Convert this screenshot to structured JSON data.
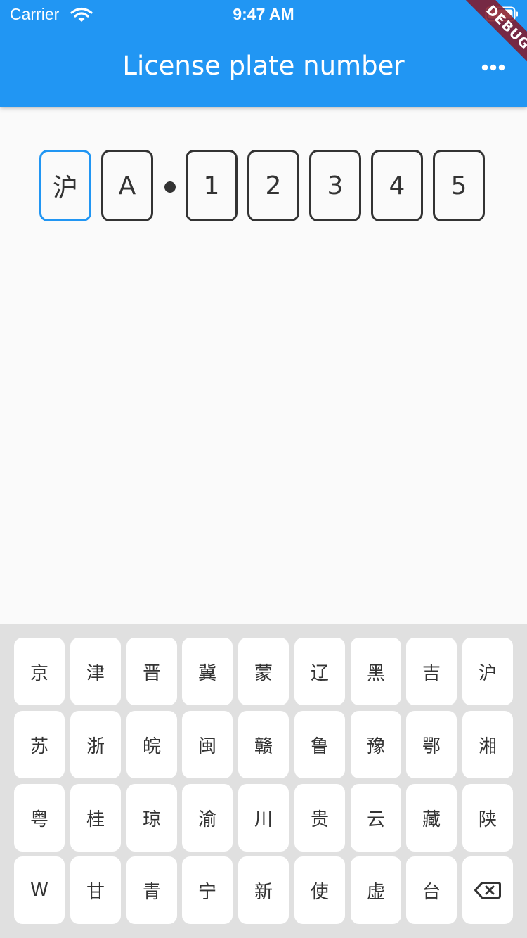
{
  "status_bar": {
    "carrier": "Carrier",
    "time": "9:47 AM"
  },
  "app_bar": {
    "title": "License plate number",
    "more_icon": "more-horiz-icon",
    "debug_label": "DEBUG"
  },
  "colors": {
    "primary": "#2196f3",
    "box_border": "#333333",
    "keyboard_bg": "#e0e0e0",
    "debug_ribbon": "#851624"
  },
  "plate": {
    "chars": [
      "沪",
      "A",
      "1",
      "2",
      "3",
      "4",
      "5"
    ],
    "active_index": 0
  },
  "keyboard": {
    "rows": [
      [
        "京",
        "津",
        "晋",
        "冀",
        "蒙",
        "辽",
        "黑",
        "吉",
        "沪"
      ],
      [
        "苏",
        "浙",
        "皖",
        "闽",
        "赣",
        "鲁",
        "豫",
        "鄂",
        "湘"
      ],
      [
        "粤",
        "桂",
        "琼",
        "渝",
        "川",
        "贵",
        "云",
        "藏",
        "陕"
      ],
      [
        "W",
        "甘",
        "青",
        "宁",
        "新",
        "使",
        "虚",
        "台"
      ]
    ],
    "delete_icon": "backspace-icon"
  }
}
